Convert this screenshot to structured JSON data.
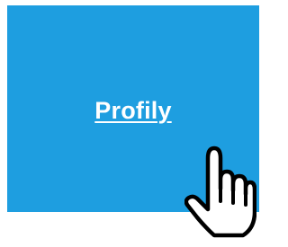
{
  "tile": {
    "label": "Profily",
    "background_color": "#1e9ee0",
    "text_color": "#ffffff"
  },
  "cursor": {
    "icon": "hand-pointer-icon"
  }
}
